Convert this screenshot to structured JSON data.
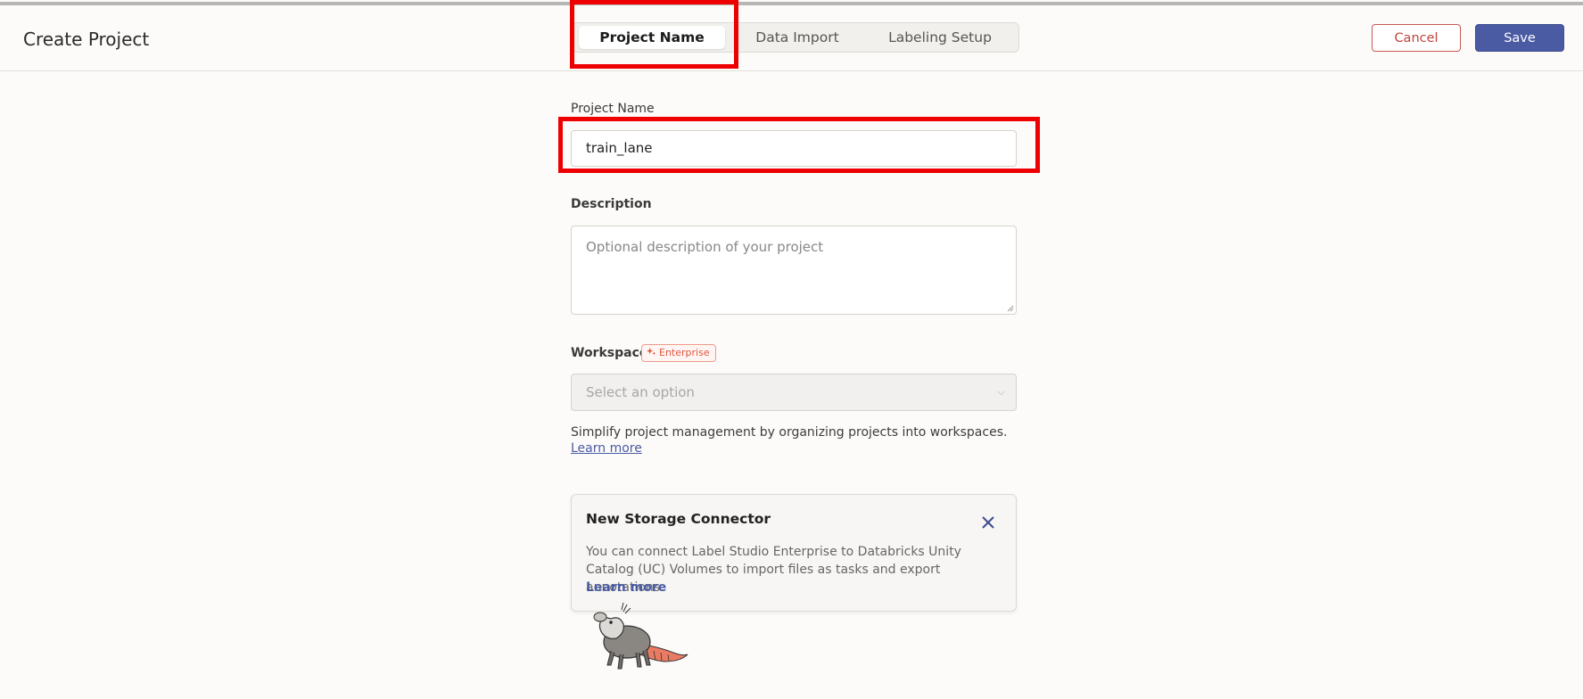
{
  "header": {
    "title": "Create Project",
    "tabs": [
      {
        "label": "Project Name",
        "active": true
      },
      {
        "label": "Data Import",
        "active": false
      },
      {
        "label": "Labeling Setup",
        "active": false
      }
    ],
    "cancel_label": "Cancel",
    "save_label": "Save"
  },
  "form": {
    "name_label": "Project Name",
    "name_value": "train_lane",
    "description_label": "Description",
    "description_placeholder": "Optional description of your project",
    "workspace_label": "Workspace",
    "workspace_badge": "Enterprise",
    "workspace_placeholder": "Select an option",
    "workspace_hint": "Simplify project management by organizing projects into workspaces. ",
    "workspace_hint_link": "Learn more"
  },
  "notice": {
    "title": "New Storage Connector",
    "body": "You can connect Label Studio Enterprise to Databricks Unity Catalog (UC) Volumes to import files as tasks and export annotations.",
    "link": "Learn more"
  },
  "colors": {
    "accent": "#4b5ba3",
    "danger": "#c0433c",
    "highlight": "#ee0000",
    "background": "#fcfbf9"
  },
  "icons": [
    "sparkle-icon",
    "chevron-down-icon",
    "close-icon",
    "opossum-mascot"
  ]
}
